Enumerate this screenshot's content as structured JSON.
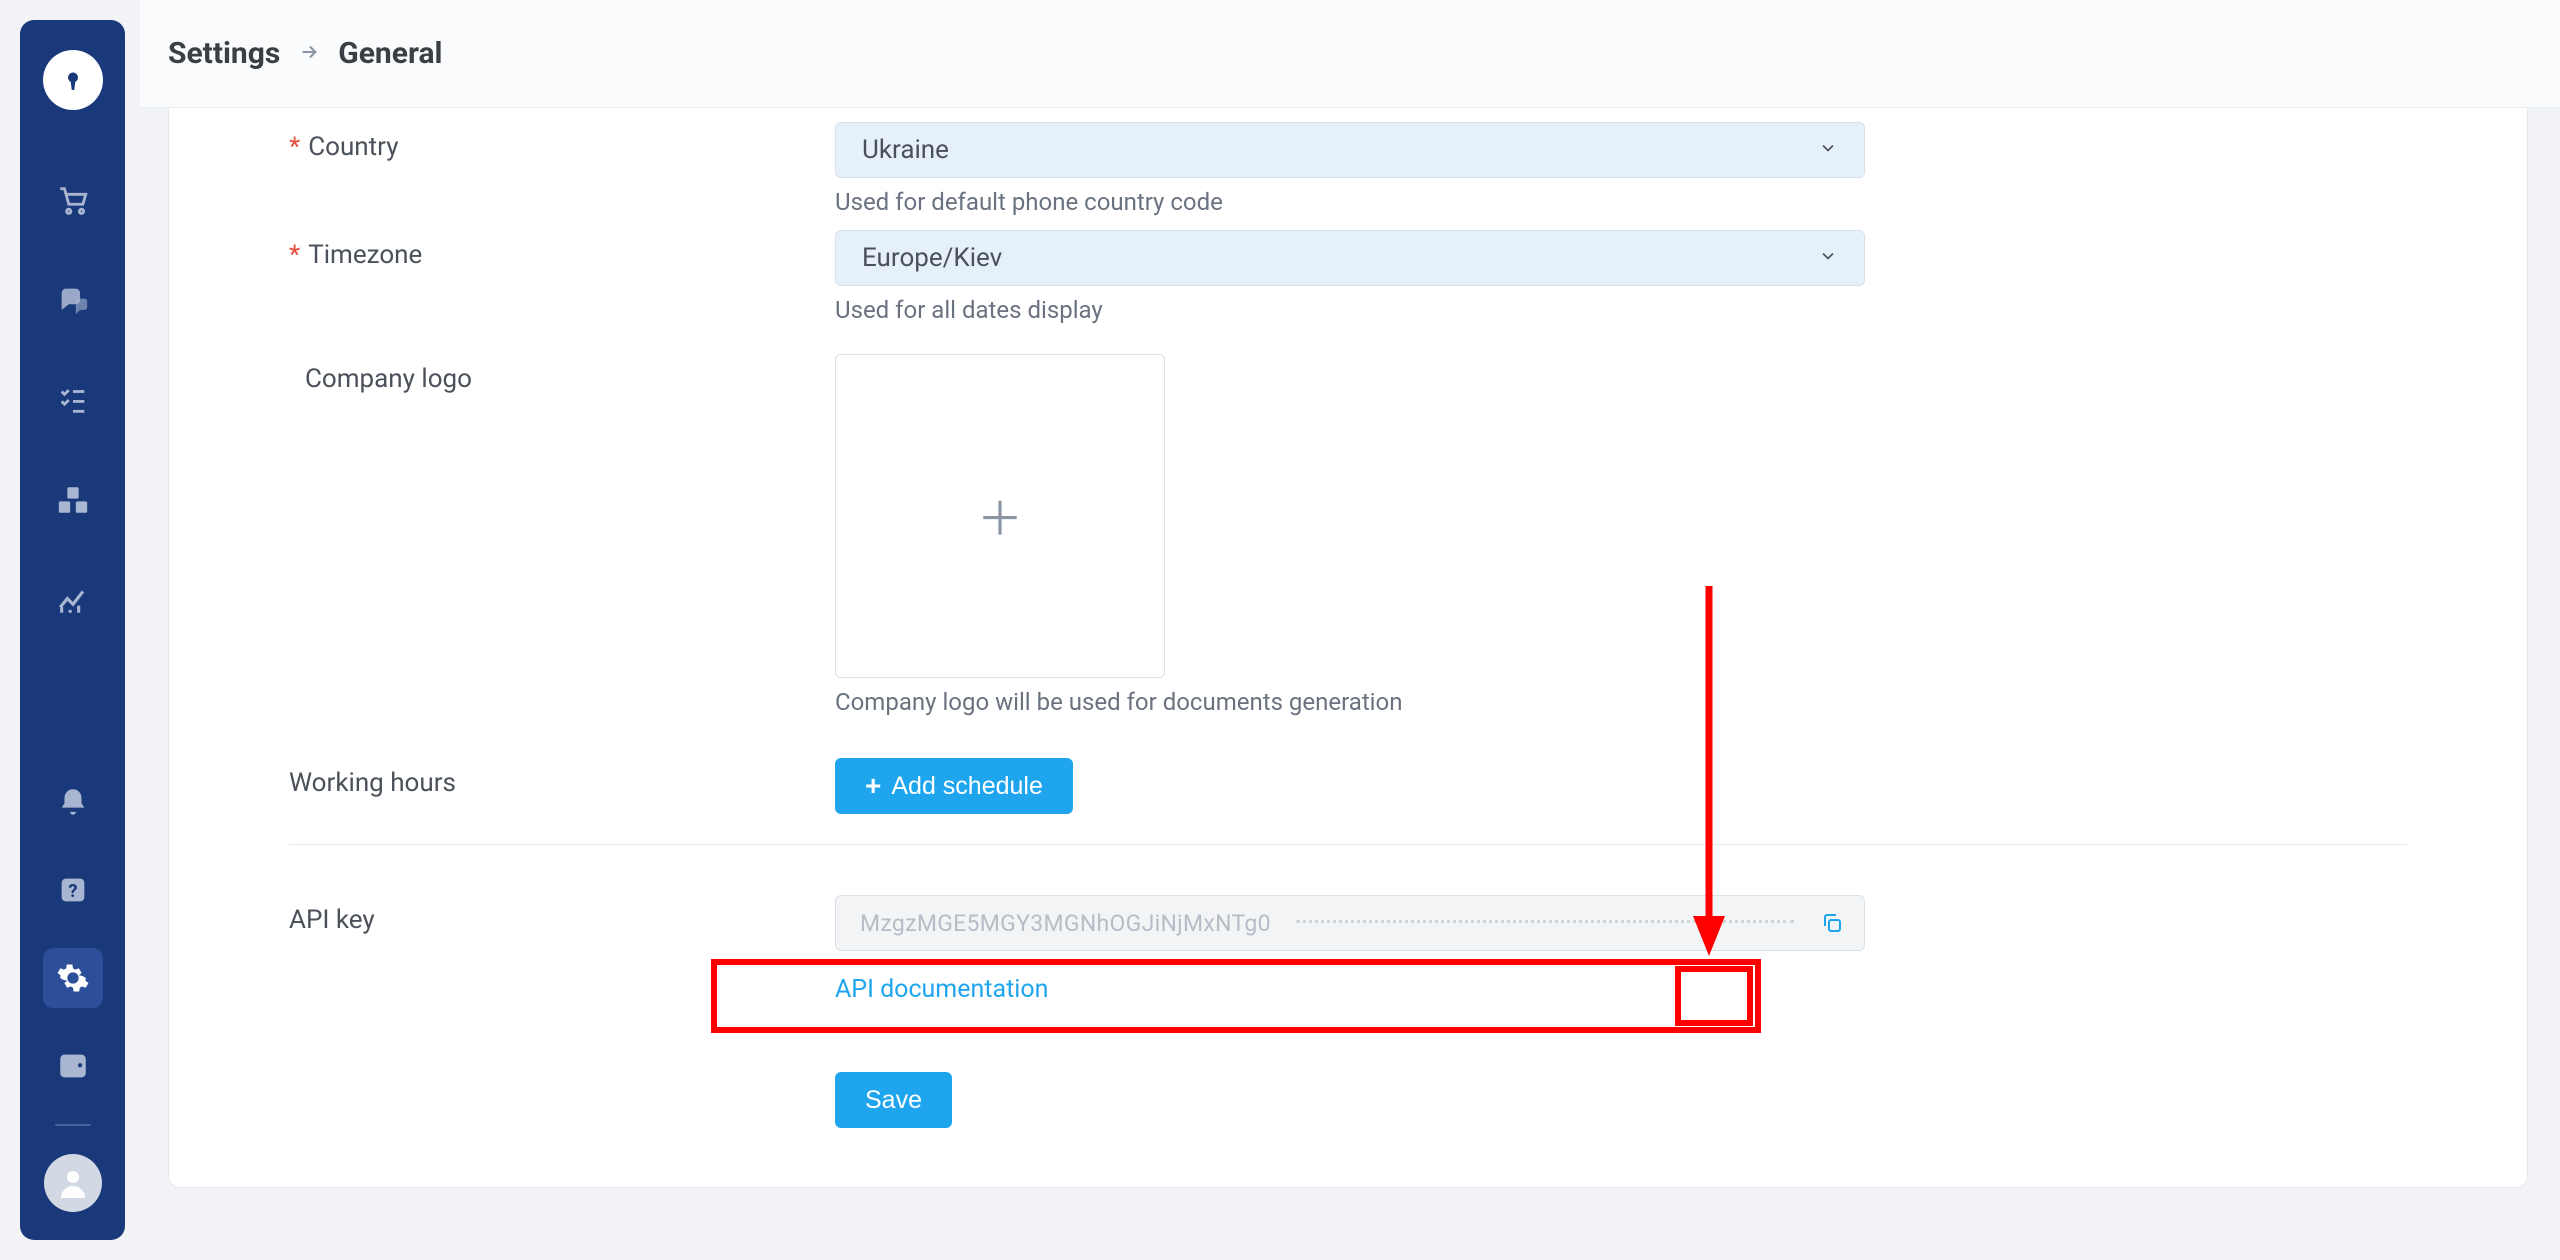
{
  "breadcrumb": {
    "parent": "Settings",
    "current": "General"
  },
  "country": {
    "label": "Country",
    "value": "Ukraine",
    "help": "Used for default phone country code"
  },
  "timezone": {
    "label": "Timezone",
    "value": "Europe/Kiev",
    "help": "Used for all dates display"
  },
  "logo": {
    "label": "Company logo",
    "help": "Company logo will be used for documents generation"
  },
  "hours": {
    "label": "Working hours",
    "button": "Add schedule"
  },
  "api": {
    "label": "API key",
    "value_visible": "MzgzMGE5MGY3MGNhOGJiNjMxNTg0",
    "doc_link": "API documentation"
  },
  "save": {
    "label": "Save"
  },
  "colors": {
    "sidebar": "#1a397a",
    "accent": "#1ea5ee",
    "annotation": "#ff0000"
  }
}
